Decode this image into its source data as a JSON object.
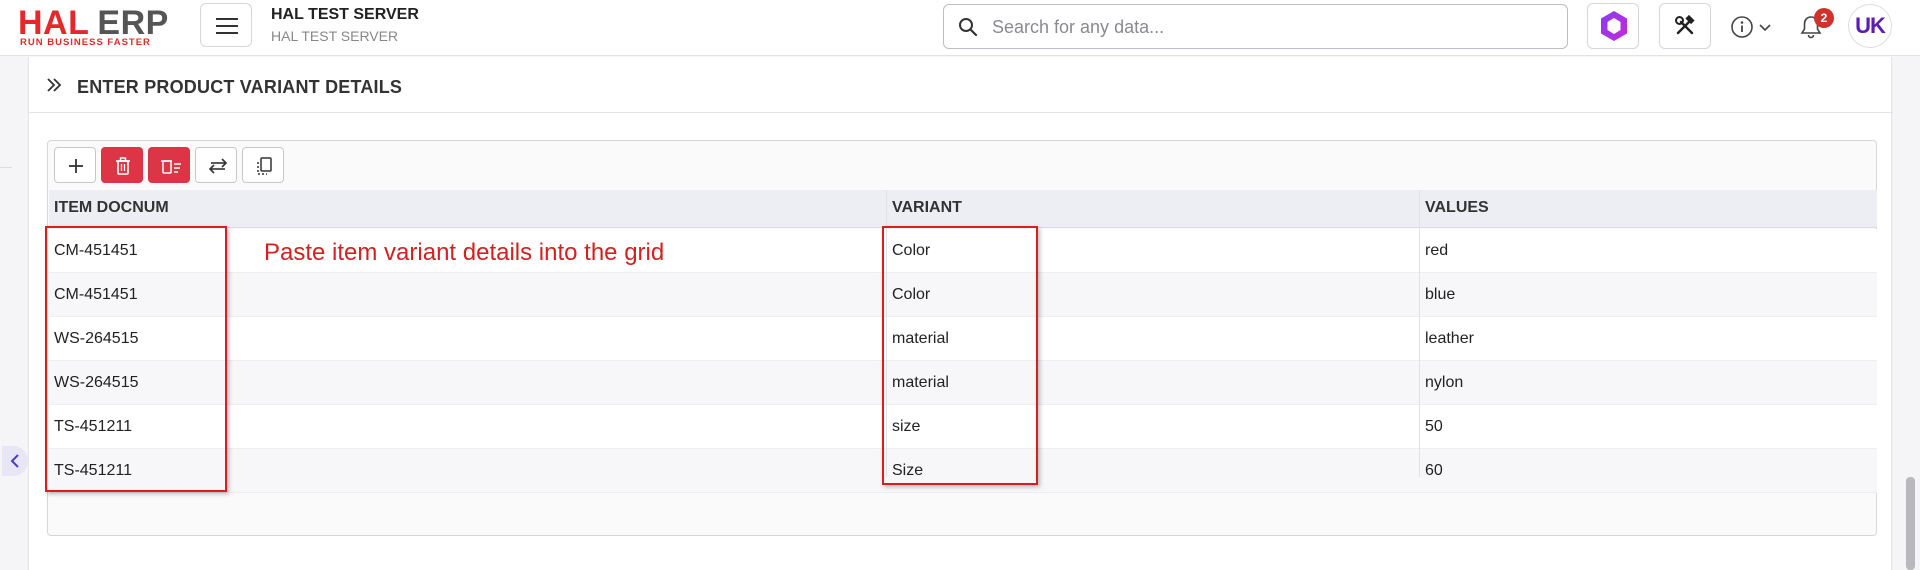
{
  "header": {
    "logo_main_left": "HAL",
    "logo_main_right": "ERP",
    "logo_tagline": "RUN BUSINESS FASTER",
    "server_title": "HAL TEST SERVER",
    "server_subtitle": "HAL TEST SERVER",
    "search_placeholder": "Search for any data...",
    "notification_count": "2",
    "avatar_initials": "UK",
    "brand_color": "#e32a2a",
    "avatar_color": "#5a1fb0"
  },
  "section": {
    "title": "ENTER PRODUCT VARIANT DETAILS"
  },
  "toolbar": {
    "buttons": [
      {
        "icon": "plus-icon",
        "variant": "default"
      },
      {
        "icon": "trash-icon",
        "variant": "danger"
      },
      {
        "icon": "delete-rows-icon",
        "variant": "danger"
      },
      {
        "icon": "swap-arrows-icon",
        "variant": "default"
      },
      {
        "icon": "paste-clipboard-icon",
        "variant": "default"
      }
    ]
  },
  "grid": {
    "columns": [
      "ITEM DOCNUM",
      "VARIANT",
      "VALUES"
    ],
    "rows": [
      [
        "CM-451451",
        "Color",
        "red"
      ],
      [
        "CM-451451",
        "Color",
        "blue"
      ],
      [
        "WS-264515",
        "material",
        "leather"
      ],
      [
        "WS-264515",
        "material",
        "nylon"
      ],
      [
        "TS-451211",
        "size",
        "50"
      ],
      [
        "TS-451211",
        "Size",
        "60"
      ]
    ]
  },
  "annotation": {
    "text": "Paste item variant details into the grid",
    "color": "#d42020"
  }
}
